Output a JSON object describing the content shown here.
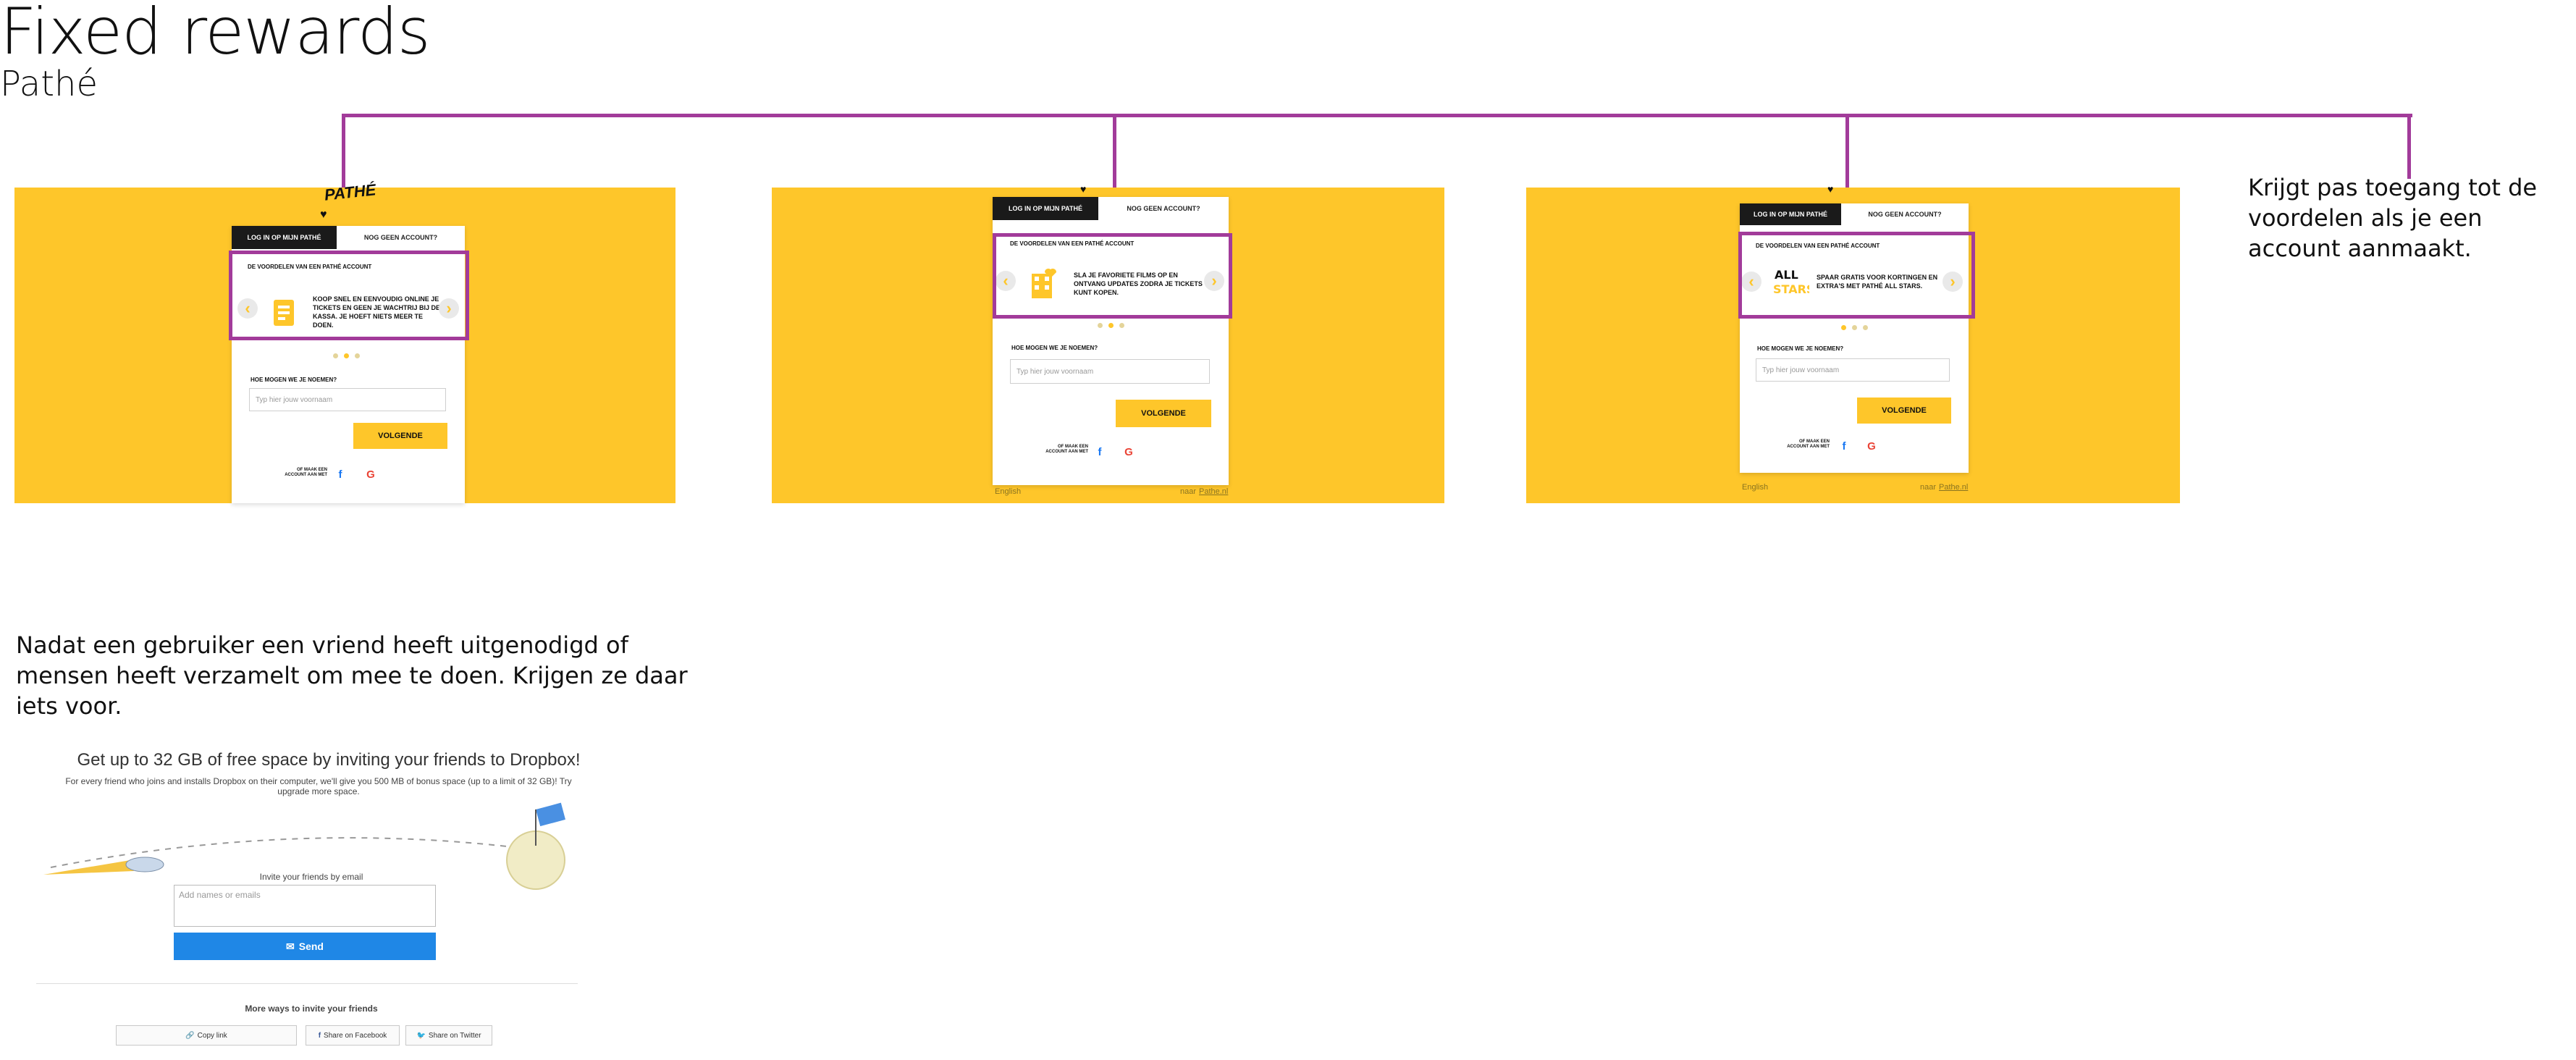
{
  "header": {
    "title": "Fixed rewards",
    "subtitle": "Pathé"
  },
  "notes": {
    "top_right": "Krijgt pas toegang tot de voordelen als je een account aanmaakt.",
    "bottom_left": "Nadat een gebruiker een vriend heeft uitgenodigd of mensen heeft verzamelt om mee te doen. Krijgen ze daar iets voor."
  },
  "colors": {
    "pathe_yellow": "#FEC62A",
    "highlight_purple": "#A23B9A",
    "dropbox_blue": "#1F87E6"
  },
  "pathe": {
    "logo": "PATHÉ",
    "tab_login": "Log in op mijn Pathé",
    "tab_no_account": "Nog geen account?",
    "form_label": "Hoe mogen we je noemen?",
    "input_placeholder": "Typ hier jouw voornaam",
    "next_button": "Volgende",
    "social_label": "Of maak een account aan met",
    "footer_language": "English",
    "footer_link_prefix": "naar",
    "footer_link": "Pathe.nl",
    "screens": [
      {
        "carousel_title": "De voordelen van een Pathé account",
        "carousel_text": "Koop snel en eenvoudig online je tickets en geen je wachtrij bij de kassa. Je hoeft niets meer te doen.",
        "icon": "ticket-icon"
      },
      {
        "carousel_title": "De voordelen van een Pathé account",
        "carousel_text": "Sla je favoriete films op en ontvang updates zodra je tickets kunt kopen.",
        "icon": "film-heart-icon"
      },
      {
        "carousel_title": "De voordelen van een Pathé account",
        "carousel_text": "Spaar gratis voor kortingen en extra's met Pathé All Stars.",
        "icon": "all-stars-icon"
      }
    ]
  },
  "dropbox": {
    "heading": "Get up to 32 GB of free space by inviting your friends to Dropbox!",
    "subtext": "For every friend who joins and installs Dropbox on their computer, we'll give you 500 MB of bonus space (up to a limit of 32 GB)! Try upgrade more space.",
    "invite_label": "Invite your friends by email",
    "input_placeholder": "Add names or emails",
    "send_button": "Send",
    "more_ways": "More ways to invite your friends",
    "copy_link": "Copy link",
    "share_facebook": "Share on Facebook",
    "share_twitter": "Share on Twitter"
  }
}
